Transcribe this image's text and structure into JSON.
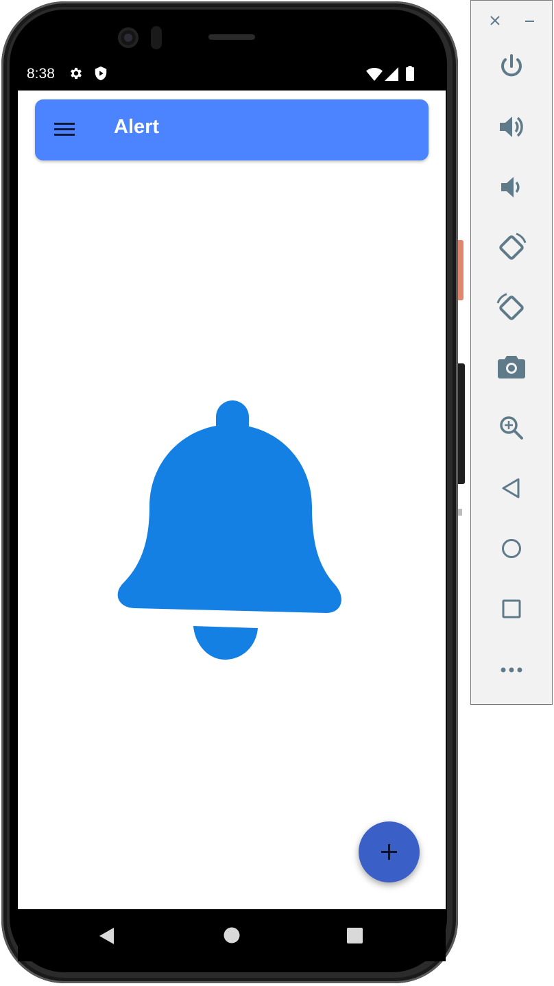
{
  "status_bar": {
    "time": "8:38",
    "icons": [
      "gear-icon",
      "play-shield-icon",
      "wifi-icon",
      "signal-icon",
      "battery-icon"
    ]
  },
  "app_bar": {
    "title": "Alert",
    "menu_icon": "menu-icon",
    "color": "#4c84ff"
  },
  "main": {
    "icon": "bell-icon",
    "icon_color": "#1580e3"
  },
  "fab": {
    "icon": "plus-icon",
    "color": "#3a5fc7"
  },
  "nav_bar": {
    "buttons": [
      "back-icon",
      "home-icon",
      "recents-icon"
    ]
  },
  "emulator_toolbar": {
    "window_controls": [
      "close-icon",
      "minimize-icon"
    ],
    "buttons": [
      "power-icon",
      "volume-up-icon",
      "volume-down-icon",
      "rotate-left-icon",
      "rotate-right-icon",
      "camera-icon",
      "zoom-icon",
      "back-icon",
      "home-icon",
      "overview-icon",
      "more-icon"
    ],
    "icon_color": "#5f7b8a"
  }
}
